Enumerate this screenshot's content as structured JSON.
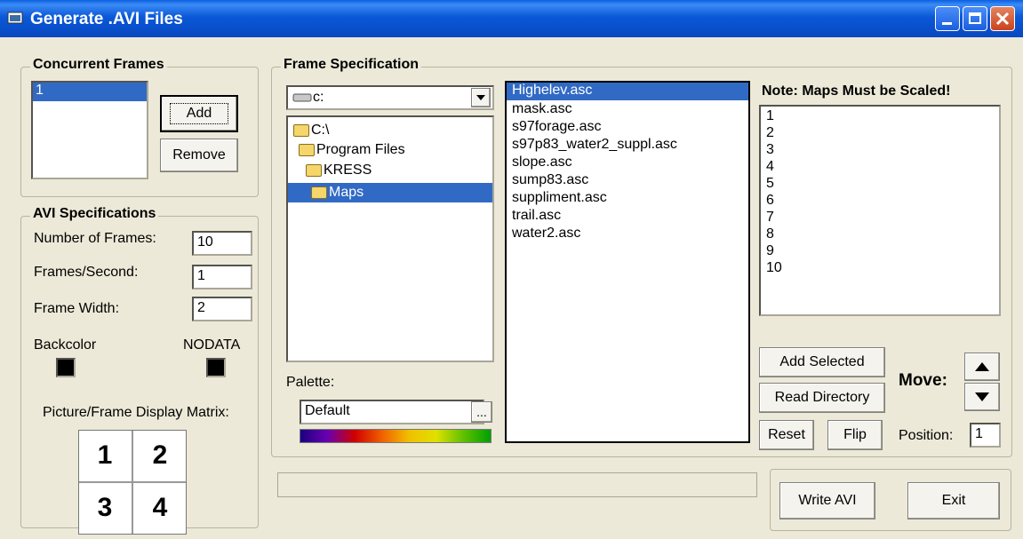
{
  "window": {
    "title": "Generate .AVI Files"
  },
  "concurrent": {
    "legend": "Concurrent Frames",
    "items": [
      "1"
    ],
    "add_label": "Add",
    "remove_label": "Remove"
  },
  "avi": {
    "legend": "AVI Specifications",
    "num_frames_label": "Number of Frames:",
    "num_frames_value": "10",
    "fps_label": "Frames/Second:",
    "fps_value": "1",
    "width_label": "Frame Width:",
    "width_value": "2",
    "backcolor_label": "Backcolor",
    "nodata_label": "NODATA",
    "matrix_label": "Picture/Frame Display Matrix:",
    "matrix": [
      "1",
      "2",
      "3",
      "4"
    ]
  },
  "framespec": {
    "legend": "Frame Specification",
    "drive": "c:",
    "tree": [
      "C:\\",
      "Program Files",
      "KRESS",
      "Maps"
    ],
    "files": [
      "Highelev.asc",
      "mask.asc",
      "s97forage.asc",
      "s97p83_water2_suppl.asc",
      "slope.asc",
      "sump83.asc",
      "suppliment.asc",
      "trail.asc",
      "water2.asc"
    ],
    "palette_label": "Palette:",
    "palette_value": "Default",
    "browse_label": "..."
  },
  "right": {
    "note": "Note: Maps Must be Scaled!",
    "numbers": [
      "1",
      "2",
      "3",
      "4",
      "5",
      "6",
      "7",
      "8",
      "9",
      "10"
    ],
    "add_selected": "Add Selected",
    "read_directory": "Read Directory",
    "reset": "Reset",
    "flip": "Flip",
    "move_label": "Move:",
    "position_label": "Position:",
    "position_value": "1"
  },
  "bottom": {
    "write_avi": "Write AVI",
    "exit": "Exit"
  }
}
